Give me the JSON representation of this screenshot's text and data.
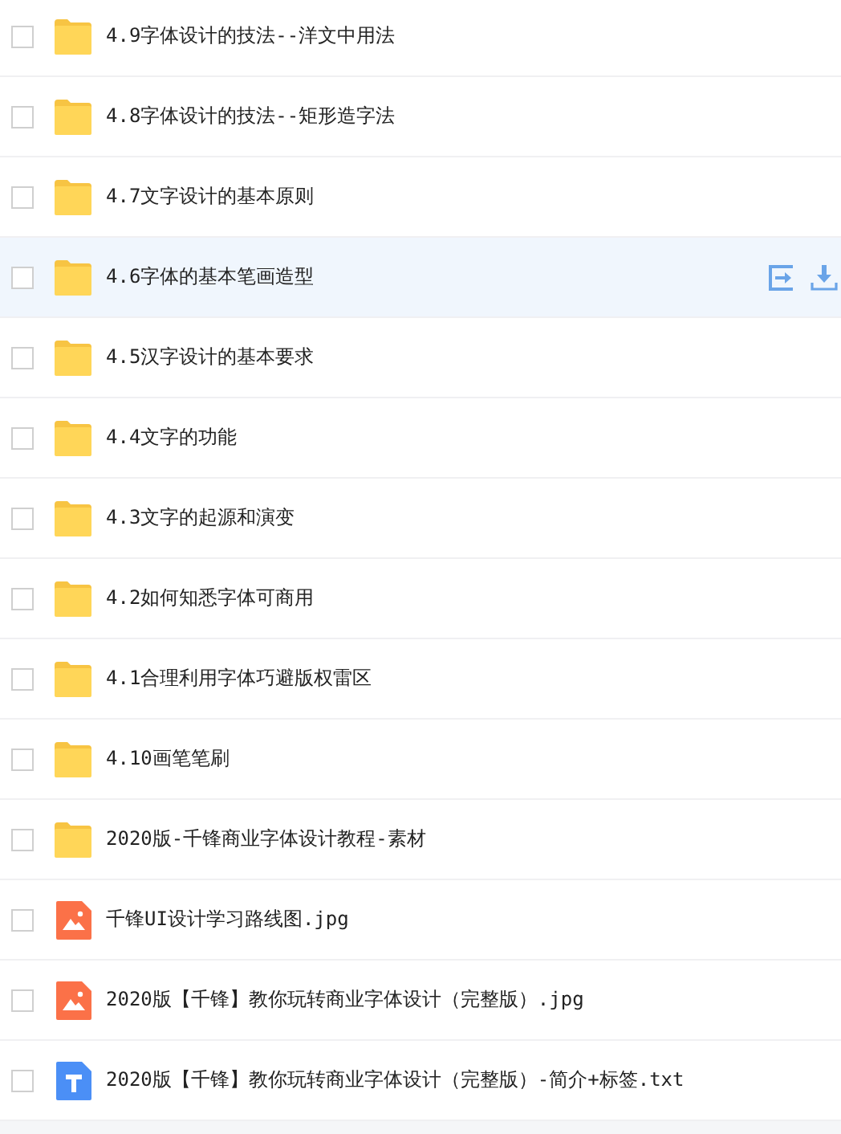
{
  "files": [
    {
      "kind": "folder",
      "name": "4.9字体设计的技法--洋文中用法",
      "checked": false,
      "highlighted": false
    },
    {
      "kind": "folder",
      "name": "4.8字体设计的技法--矩形造字法",
      "checked": false,
      "highlighted": false
    },
    {
      "kind": "folder",
      "name": "4.7文字设计的基本原则",
      "checked": false,
      "highlighted": false
    },
    {
      "kind": "folder",
      "name": "4.6字体的基本笔画造型",
      "checked": false,
      "highlighted": true
    },
    {
      "kind": "folder",
      "name": "4.5汉字设计的基本要求",
      "checked": false,
      "highlighted": false
    },
    {
      "kind": "folder",
      "name": "4.4文字的功能",
      "checked": false,
      "highlighted": false
    },
    {
      "kind": "folder",
      "name": "4.3文字的起源和演变",
      "checked": false,
      "highlighted": false
    },
    {
      "kind": "folder",
      "name": "4.2如何知悉字体可商用",
      "checked": false,
      "highlighted": false
    },
    {
      "kind": "folder",
      "name": "4.1合理利用字体巧避版权雷区",
      "checked": false,
      "highlighted": false
    },
    {
      "kind": "folder",
      "name": "4.10画笔笔刷",
      "checked": false,
      "highlighted": false
    },
    {
      "kind": "folder",
      "name": "2020版-千锋商业字体设计教程-素材",
      "checked": false,
      "highlighted": false
    },
    {
      "kind": "image",
      "name": "千锋UI设计学习路线图.jpg",
      "checked": false,
      "highlighted": false
    },
    {
      "kind": "image",
      "name": "2020版【千锋】教你玩转商业字体设计（完整版）.jpg",
      "checked": false,
      "highlighted": false
    },
    {
      "kind": "text",
      "name": "2020版【千锋】教你玩转商业字体设计（完整版）-简介+标签.txt",
      "checked": false,
      "highlighted": false
    }
  ]
}
